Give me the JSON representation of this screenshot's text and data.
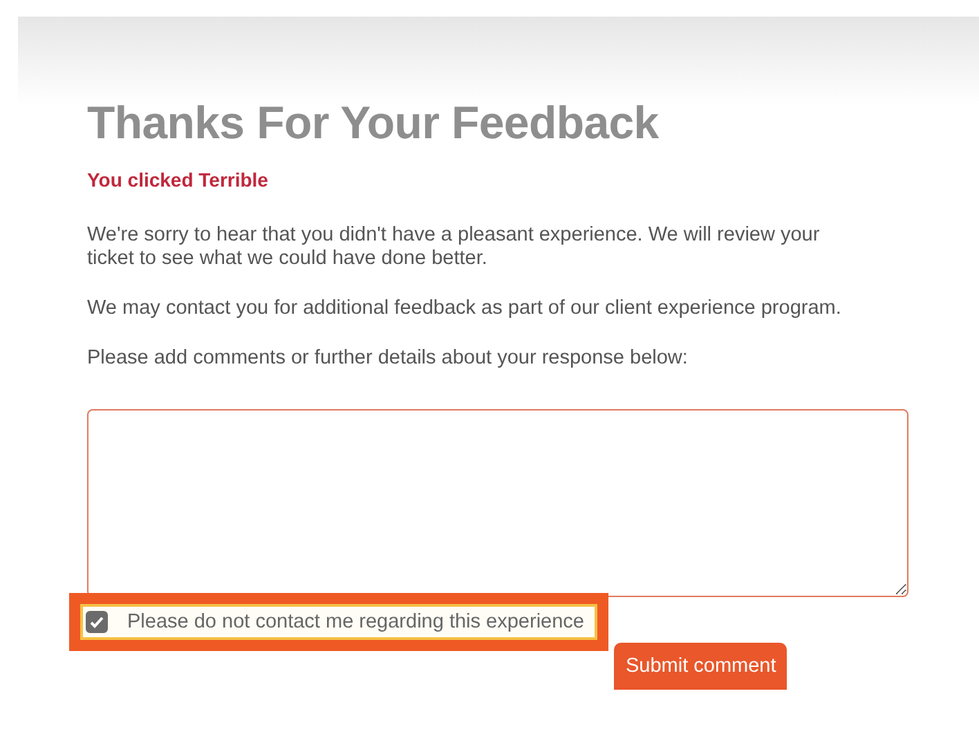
{
  "title": "Thanks For Your Feedback",
  "rating_note": "You clicked Terrible",
  "paragraphs": [
    "We're sorry to hear that you didn't have a pleasant experience. We will review your ticket to see what we could have done better.",
    "We may contact you for additional feedback as part of our client experience program.",
    "Please add comments or further details about your response below:"
  ],
  "no_contact": {
    "label": "Please do not contact me regarding this experience",
    "checked": true,
    "highlighted": true
  },
  "submit_button": "Submit comment"
}
